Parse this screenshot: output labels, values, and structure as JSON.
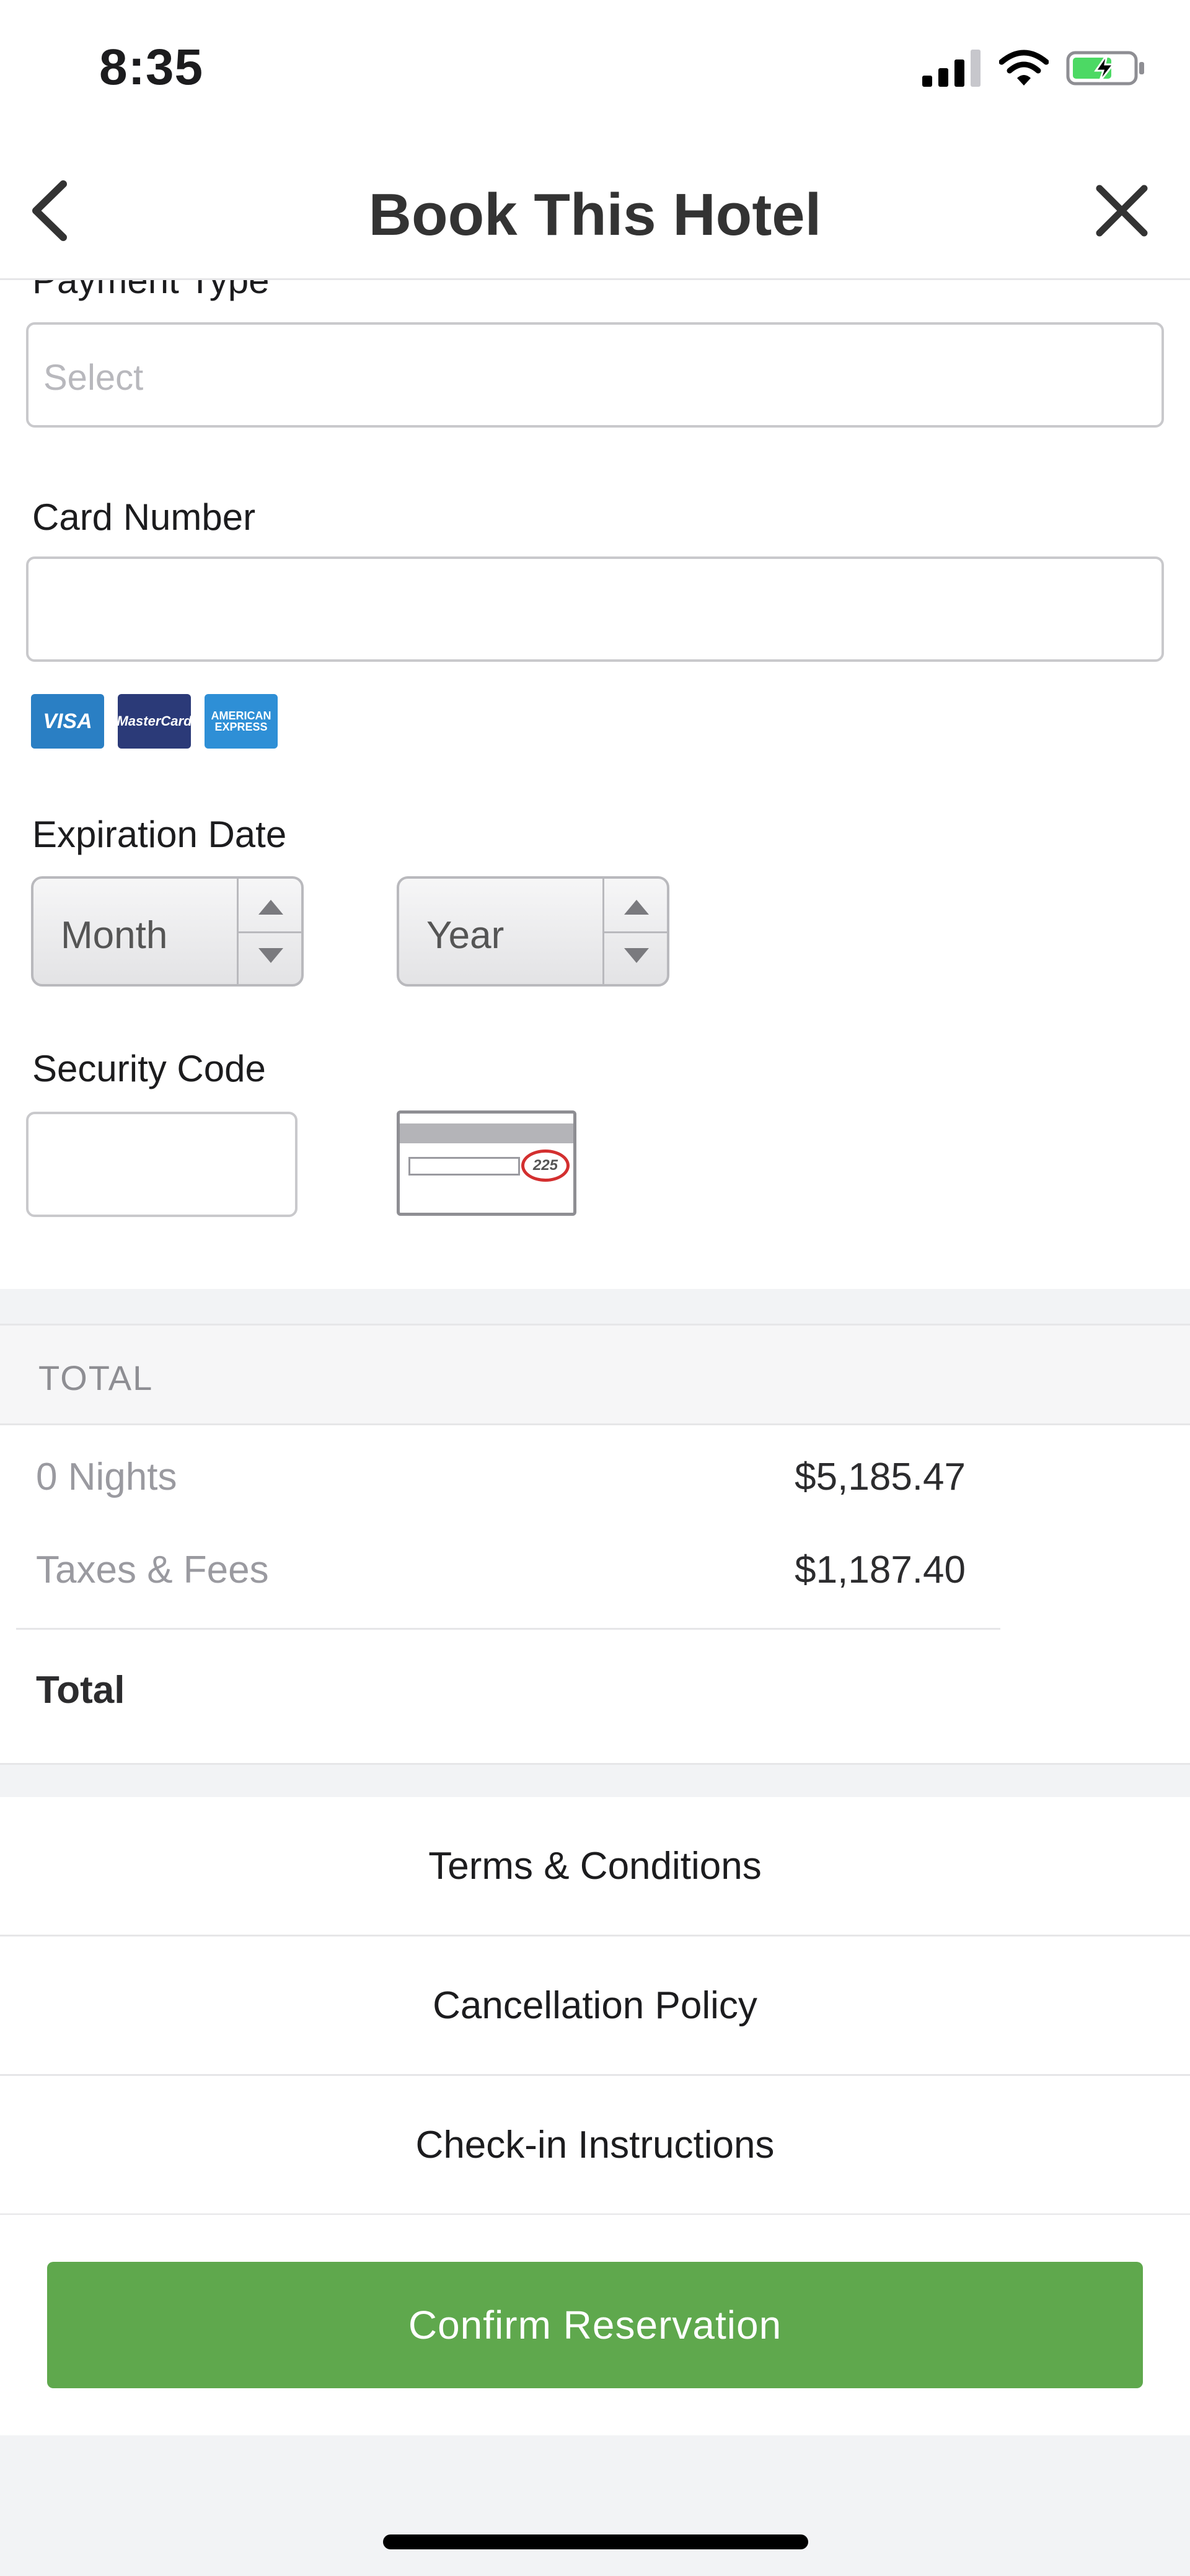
{
  "status_bar": {
    "time": "8:35"
  },
  "nav": {
    "title": "Book This Hotel"
  },
  "form": {
    "payment_type_label": "Payment Type",
    "payment_type_placeholder": "Select",
    "card_number_label": "Card Number",
    "card_brands": [
      "VISA",
      "MasterCard",
      "AMERICAN EXPRESS"
    ],
    "expiration_label": "Expiration Date",
    "month_value": "Month",
    "year_value": "Year",
    "security_code_label": "Security Code",
    "security_code_example": "225"
  },
  "total": {
    "header": "TOTAL",
    "rows": [
      {
        "label": "0 Nights",
        "value": "$5,185.47"
      },
      {
        "label": "Taxes & Fees",
        "value": "$1,187.40"
      }
    ],
    "total_label": "Total"
  },
  "links": {
    "terms": "Terms & Conditions",
    "cancellation": "Cancellation Policy",
    "checkin": "Check-in Instructions"
  },
  "confirm_button": "Confirm Reservation",
  "colors": {
    "confirm_green": "#5fa84d",
    "battery_green": "#4cd964",
    "cvv_circle_red": "#d32f2f"
  }
}
